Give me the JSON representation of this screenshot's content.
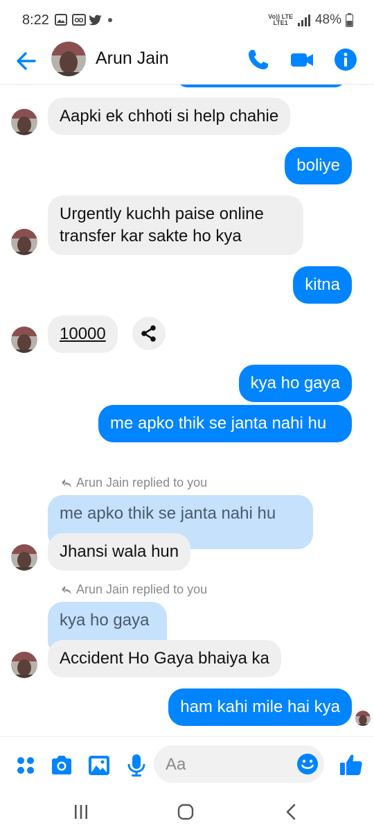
{
  "status_bar": {
    "time": "8:22",
    "network_top": "Vo)) LTE",
    "network_bottom": "LTE1",
    "battery": "48%"
  },
  "header": {
    "contact_name": "Arun Jain",
    "icons": [
      "back-arrow-icon",
      "phone-icon",
      "video-icon",
      "info-icon"
    ]
  },
  "messages": [
    {
      "from": "them",
      "text": "Aapki ek chhoti si help chahie"
    },
    {
      "from": "me",
      "text": "boliye"
    },
    {
      "from": "them",
      "text": "Urgently kuchh paise online transfer kar sakte ho kya"
    },
    {
      "from": "me",
      "text": "kitna"
    },
    {
      "from": "them",
      "text": "10000"
    },
    {
      "from": "me",
      "text": "kya ho gaya"
    },
    {
      "from": "me",
      "text": "me apko thik se janta nahi hu"
    },
    {
      "from": "them",
      "reply_label": "Arun Jain replied to you",
      "quoted": "me apko thik se janta nahi hu",
      "text": "Jhansi wala hun"
    },
    {
      "from": "them",
      "reply_label": "Arun Jain replied to you",
      "quoted": "kya ho gaya",
      "text": "Accident Ho Gaya bhaiya ka"
    },
    {
      "from": "me",
      "text": "ham kahi mile hai kya"
    }
  ],
  "composer": {
    "placeholder": "Aa",
    "icons": [
      "apps-icon",
      "camera-icon",
      "gallery-icon",
      "mic-icon",
      "emoji-icon",
      "like-icon"
    ]
  },
  "colors": {
    "accent": "#0084ff",
    "incoming_bubble": "#efefef",
    "quoted_bubble": "#c6e1fb"
  }
}
